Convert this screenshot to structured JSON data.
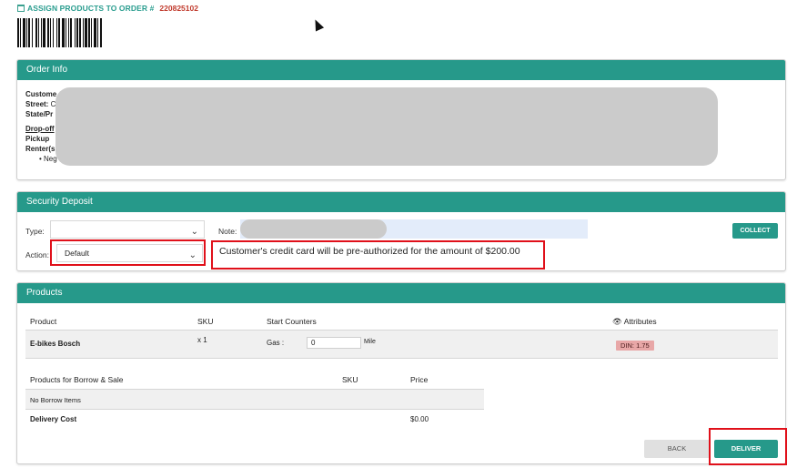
{
  "header": {
    "title": "ASSIGN PRODUCTS TO ORDER #",
    "order_number": "220825102",
    "calendar_icon": "calendar-icon",
    "barcode_icon": "barcode"
  },
  "order_info": {
    "heading": "Order Info",
    "customer_label": "Custome",
    "street_label": "Street:",
    "street_value": "C",
    "state_label": "State/Pr",
    "dropoff_label": "Drop-off",
    "pickup_label": "Pickup",
    "renter_label": "Renter(s",
    "renter_item": "Neg"
  },
  "deposit": {
    "heading": "Security Deposit",
    "type_label": "Type:",
    "type_value": "",
    "action_label": "Action:",
    "action_value": "Default",
    "note_label": "Note:",
    "collect_label": "COLLECT",
    "preauth_text": "Customer's credit card will be pre-authorized for the amount of $200.00"
  },
  "products": {
    "heading": "Products",
    "columns": {
      "product": "Product",
      "sku": "SKU",
      "start_counters": "Start Counters",
      "attributes": "Attributes"
    },
    "items": [
      {
        "name": "E-bikes Bosch",
        "qty": "x 1",
        "counter_label": "Gas :",
        "counter_value": "0",
        "counter_unit": "Mile",
        "attribute": "DIN: 1.75"
      }
    ],
    "borrow_sale": {
      "columns": {
        "name": "Products for Borrow & Sale",
        "sku": "SKU",
        "price": "Price"
      },
      "empty_text": "No Borrow Items",
      "delivery_label": "Delivery Cost",
      "delivery_value": "$0.00"
    },
    "back_label": "BACK",
    "deliver_label": "DELIVER"
  },
  "colors": {
    "accent": "#26998a",
    "highlight": "#e0101a",
    "title": "#2a9d8f",
    "order_number": "#c0392b"
  }
}
